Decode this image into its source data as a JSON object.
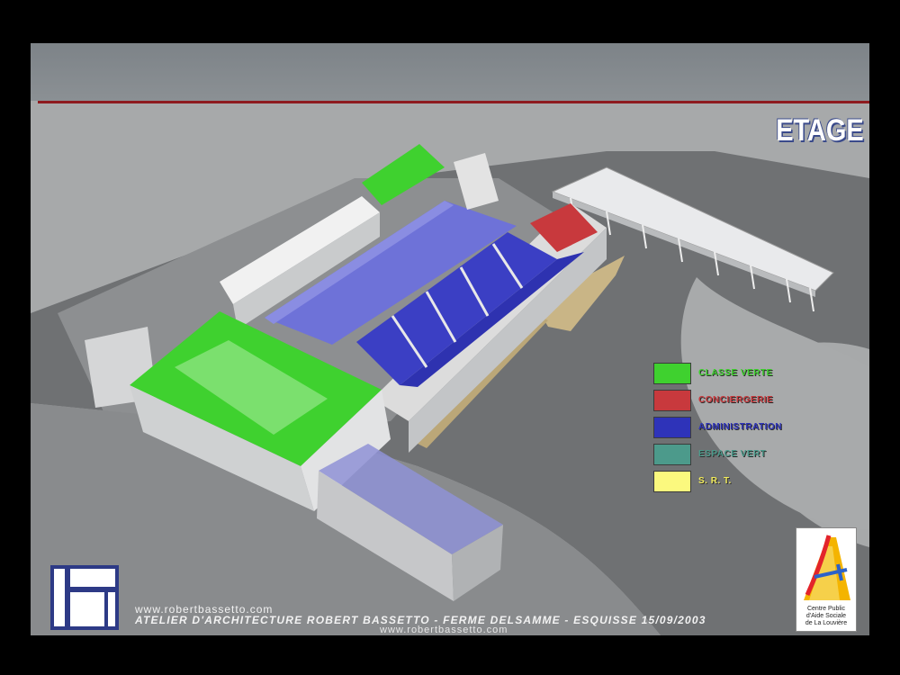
{
  "slide": {
    "title": "ETAGE"
  },
  "legend": [
    {
      "label": "CLASSE VERTE",
      "color": "#3fd12f",
      "text_color": "#3fd12f"
    },
    {
      "label": "CONCIERGERIE",
      "color": "#c8393d",
      "text_color": "#c8393d"
    },
    {
      "label": "ADMINISTRATION",
      "color": "#2e33b9",
      "text_color": "#2e33b9"
    },
    {
      "label": "ESPACE VERT",
      "color": "#4c9a8b",
      "text_color": "#4c9a8b"
    },
    {
      "label": "S. R. T.",
      "color": "#fbf97e",
      "text_color": "#f0ea5c"
    }
  ],
  "footer": {
    "url_top": "www.robertbassetto.com",
    "main_line": "ATELIER D'ARCHITECTURE ROBERT BASSETTO - FERME DELSAMME - ESQUISSE 15/09/2003",
    "url_bottom": "www.robertbassetto.com"
  },
  "cpas_logo": {
    "line1": "Centre Public",
    "line2": "d'Aide Sociale",
    "line3": "de La Louvière"
  }
}
